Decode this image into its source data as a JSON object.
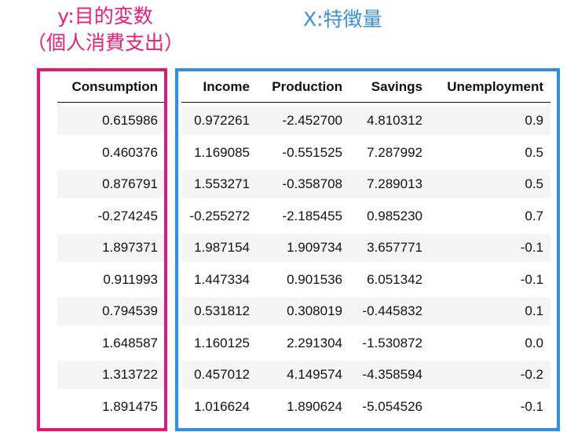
{
  "labels": {
    "y_line1": "y:目的変数",
    "y_line2": "（個人消費支出）",
    "x": "X:特徴量"
  },
  "colors": {
    "target_box": "#e2176f",
    "feature_box": "#2f8ee6",
    "target_label": "#e6207a",
    "feature_label": "#3a8fd6"
  },
  "table": {
    "columns": [
      "Consumption",
      "Income",
      "Production",
      "Savings",
      "Unemployment"
    ],
    "rows": [
      [
        "0.615986",
        "0.972261",
        "-2.452700",
        "4.810312",
        "0.9"
      ],
      [
        "0.460376",
        "1.169085",
        "-0.551525",
        "7.287992",
        "0.5"
      ],
      [
        "0.876791",
        "1.553271",
        "-0.358708",
        "7.289013",
        "0.5"
      ],
      [
        "-0.274245",
        "-0.255272",
        "-2.185455",
        "0.985230",
        "0.7"
      ],
      [
        "1.897371",
        "1.987154",
        "1.909734",
        "3.657771",
        "-0.1"
      ],
      [
        "0.911993",
        "1.447334",
        "0.901536",
        "6.051342",
        "-0.1"
      ],
      [
        "0.794539",
        "0.531812",
        "0.308019",
        "-0.445832",
        "0.1"
      ],
      [
        "1.648587",
        "1.160125",
        "2.291304",
        "-1.530872",
        "0.0"
      ],
      [
        "1.313722",
        "0.457012",
        "4.149574",
        "-4.358594",
        "-0.2"
      ],
      [
        "1.891475",
        "1.016624",
        "1.890624",
        "-5.054526",
        "-0.1"
      ]
    ]
  }
}
